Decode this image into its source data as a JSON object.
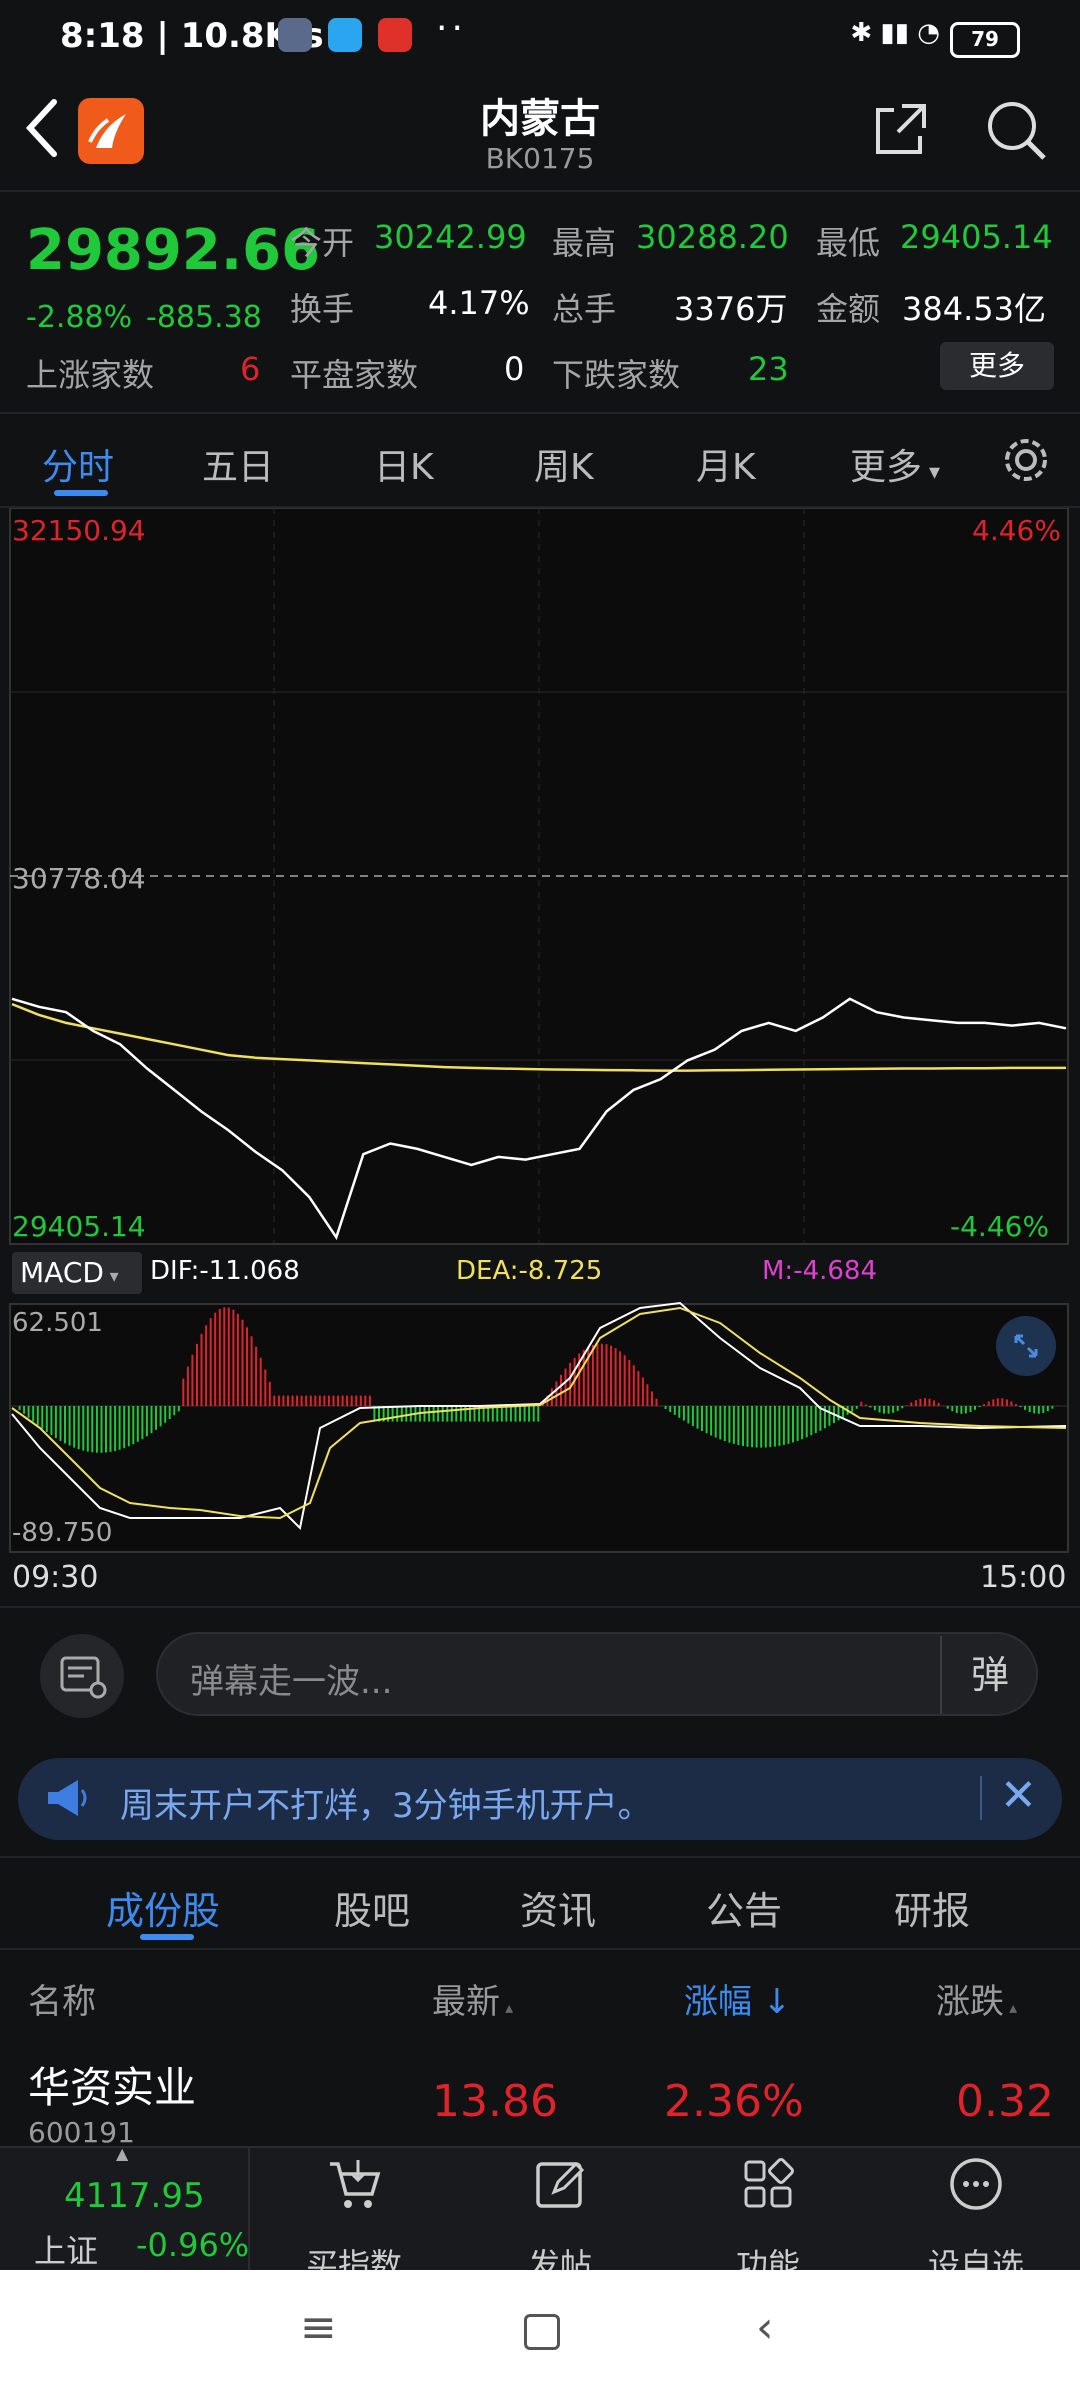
{
  "status_bar": {
    "time": "8:18 | 10.8K/s",
    "battery": "79"
  },
  "header": {
    "title": "内蒙古",
    "code": "BK0175"
  },
  "quote": {
    "price": "29892.66",
    "change_pct": "-2.88%",
    "change": "-885.38",
    "open_label": "今开",
    "open": "30242.99",
    "high_label": "最高",
    "high": "30288.20",
    "low_label": "最低",
    "low": "29405.14",
    "turnover_label": "换手",
    "turnover": "4.17%",
    "volume_label": "总手",
    "volume": "3376万",
    "amount_label": "金额",
    "amount": "384.53亿",
    "up_label": "上涨家数",
    "up_count": "6",
    "flat_label": "平盘家数",
    "flat_count": "0",
    "down_label": "下跌家数",
    "down_count": "23",
    "more_button": "更多"
  },
  "tabs": [
    "分时",
    "五日",
    "日K",
    "周K",
    "月K",
    "更多"
  ],
  "chart_labels": {
    "top_price": "32150.94",
    "top_pct": "4.46%",
    "mid_price": "30778.04",
    "bottom_price": "29405.14",
    "bottom_pct": "-4.46%",
    "macd_select": "MACD",
    "dif": "DIF:-11.068",
    "dea": "DEA:-8.725",
    "m": "M:-4.684",
    "macd_top": "62.501",
    "macd_bottom": "-89.750",
    "time_start": "09:30",
    "time_end": "15:00"
  },
  "chart_data": {
    "type": "line",
    "ylim": [
      29405.14,
      32150.94
    ],
    "reference": 30778.04,
    "series": [
      {
        "values": [
          30320,
          30290,
          30270,
          30200,
          30150,
          30060,
          29980,
          29900,
          29830,
          29750,
          29680,
          29580,
          29430,
          29740,
          29780,
          29760,
          29730,
          29700,
          29730,
          29720,
          29740,
          29760,
          29900,
          29980,
          30020,
          30090,
          30130,
          30200,
          30230,
          30200,
          30250,
          30320,
          30270,
          30250,
          30240,
          30230,
          30230,
          30220,
          30230,
          30210
        ]
      },
      {
        "values": [
          30300,
          30260,
          30230,
          30210,
          30190,
          30170,
          30150,
          30130,
          30110,
          30100,
          30095,
          30090,
          30085,
          30080,
          30075,
          30070,
          30065,
          30062,
          30060,
          30058,
          30056,
          30055,
          30054,
          30053,
          30052,
          30052,
          30053,
          30054,
          30055,
          30056,
          30057,
          30058,
          30059,
          30060,
          30060,
          30061,
          30061,
          30062,
          30062,
          30062
        ]
      }
    ]
  },
  "comment": {
    "placeholder": "弹幕走一波...",
    "right_icon": "弹"
  },
  "ad": {
    "text": "周末开户不打烊，3分钟手机开户。"
  },
  "sub_tabs": [
    "成份股",
    "股吧",
    "资讯",
    "公告",
    "研报"
  ],
  "columns": {
    "name": "名称",
    "latest": "最新",
    "change_pct": "涨幅",
    "change": "涨跌"
  },
  "rows": [
    {
      "name": "华资实业",
      "code": "600191",
      "latest": "13.86",
      "change_pct": "2.36%",
      "change": "0.32"
    }
  ],
  "bottom_bar": {
    "index_value": "4117.95",
    "index_name": "上证",
    "index_change": "-0.96%",
    "buy_label": "买指数",
    "post_label": "发帖",
    "func_label": "功能",
    "watch_label": "设自选"
  },
  "colors": {
    "up": "#e0232a",
    "down": "#1fc93a",
    "accent": "#3d8bf0"
  }
}
